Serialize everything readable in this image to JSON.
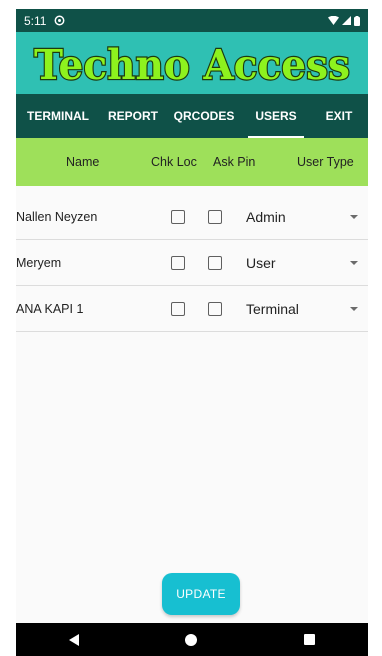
{
  "status_bar": {
    "time": "5:11"
  },
  "banner": {
    "title": "Techno Access",
    "text_color": "#8ef21e",
    "outline_color": "#1c3a10",
    "background": "#2fc0b3"
  },
  "tabs": [
    {
      "label": "TERMINAL",
      "active": false
    },
    {
      "label": "REPORT",
      "active": false
    },
    {
      "label": "QRCODES",
      "active": false
    },
    {
      "label": "USERS",
      "active": true
    },
    {
      "label": "EXIT",
      "active": false
    }
  ],
  "table": {
    "headers": {
      "name": "Name",
      "chk_loc": "Chk Loc",
      "ask_pin": "Ask Pin",
      "user_type": "User Type"
    },
    "rows": [
      {
        "name": "Nallen Neyzen",
        "chk_loc": false,
        "ask_pin": false,
        "user_type": "Admin"
      },
      {
        "name": "Meryem",
        "chk_loc": false,
        "ask_pin": false,
        "user_type": "User"
      },
      {
        "name": "ANA KAPI 1",
        "chk_loc": false,
        "ask_pin": false,
        "user_type": "Terminal"
      }
    ]
  },
  "update_button": {
    "label": "UPDATE"
  },
  "colors": {
    "primary_dark": "#0f5148",
    "header_green": "#9ee05a",
    "button_cyan": "#17bfd1"
  }
}
